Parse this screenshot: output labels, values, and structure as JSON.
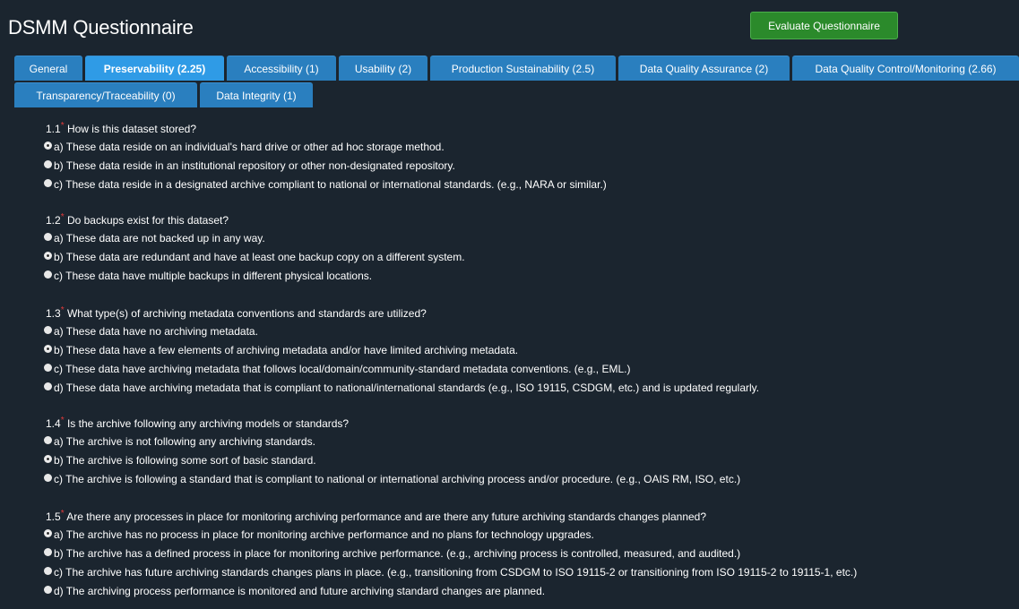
{
  "header": {
    "title": "DSMM Questionnaire",
    "evaluate_label": "Evaluate Questionnaire"
  },
  "tabs": [
    {
      "label": "General",
      "active": false
    },
    {
      "label": "Preservability (2.25)",
      "active": true
    },
    {
      "label": "Accessibility (1)",
      "active": false
    },
    {
      "label": "Usability (2)",
      "active": false
    },
    {
      "label": "Production Sustainability (2.5)",
      "active": false
    },
    {
      "label": "Data Quality Assurance (2)",
      "active": false
    },
    {
      "label": "Data Quality Control/Monitoring (2.66)",
      "active": false
    },
    {
      "label": "Transparency/Traceability (0)",
      "active": false
    },
    {
      "label": "Data Integrity (1)",
      "active": false
    }
  ],
  "questions": [
    {
      "number": "1.1",
      "required_mark": "*",
      "text": "How is this dataset stored?",
      "options": [
        {
          "label": "a) These data reside on an individual's hard drive or other ad hoc storage method.",
          "checked": true
        },
        {
          "label": "b) These data reside in an institutional repository or other non-designated repository.",
          "checked": false
        },
        {
          "label": "c) These data reside in a designated archive compliant to national or international standards. (e.g., NARA or similar.)",
          "checked": false
        }
      ]
    },
    {
      "number": "1.2",
      "required_mark": "*",
      "text": "Do backups exist for this dataset?",
      "options": [
        {
          "label": "a) These data are not backed up in any way.",
          "checked": false
        },
        {
          "label": "b) These data are redundant and have at least one backup copy on a different system.",
          "checked": true
        },
        {
          "label": "c) These data have multiple backups in different physical locations.",
          "checked": false
        }
      ]
    },
    {
      "number": "1.3",
      "required_mark": "*",
      "text": "What type(s) of archiving metadata conventions and standards are utilized?",
      "options": [
        {
          "label": "a) These data have no archiving metadata.",
          "checked": false
        },
        {
          "label": "b) These data have a few elements of archiving metadata and/or have limited archiving metadata.",
          "checked": true
        },
        {
          "label": "c) These data have archiving metadata that follows local/domain/community-standard metadata conventions. (e.g., EML.)",
          "checked": false
        },
        {
          "label": "d) These data have archiving metadata that is compliant to national/international standards (e.g., ISO 19115, CSDGM, etc.) and is updated regularly.",
          "checked": false
        }
      ]
    },
    {
      "number": "1.4",
      "required_mark": "*",
      "text": "Is the archive following any archiving models or standards?",
      "options": [
        {
          "label": "a) The archive is not following any archiving standards.",
          "checked": false
        },
        {
          "label": "b) The archive is following some sort of basic standard.",
          "checked": true
        },
        {
          "label": "c) The archive is following a standard that is compliant to national or international archiving process and/or procedure. (e.g., OAIS RM, ISO, etc.)",
          "checked": false
        }
      ]
    },
    {
      "number": "1.5",
      "required_mark": "*",
      "text": "Are there any processes in place for monitoring archiving performance and are there any future archiving standards changes planned?",
      "options": [
        {
          "label": "a) The archive has no process in place for monitoring archive performance and no plans for technology upgrades.",
          "checked": true
        },
        {
          "label": "b) The archive has a defined process in place for monitoring archive performance. (e.g., archiving process is controlled, measured, and audited.)",
          "checked": false
        },
        {
          "label": "c) The archive has future archiving standards changes plans in place. (e.g., transitioning from CSDGM to ISO 19115-2 or transitioning from ISO 19115-2 to 19115-1, etc.)",
          "checked": false
        },
        {
          "label": "d) The archiving process performance is monitored and future archiving standard changes are planned.",
          "checked": false
        }
      ]
    }
  ]
}
